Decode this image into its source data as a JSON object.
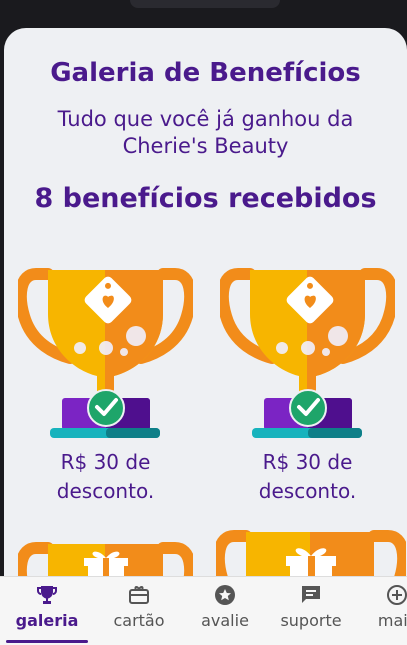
{
  "header": {
    "title": "Galeria de Benefícios",
    "subtitle": "Tudo que você já ganhou da Cherie's Beauty",
    "count_label": "8 benefícios recebidos"
  },
  "benefits": [
    {
      "label": "R$ 30 de desconto.",
      "icon": "trophy-tag-heart-icon"
    },
    {
      "label": "R$ 30 de desconto.",
      "icon": "trophy-tag-heart-icon"
    },
    {
      "label": "",
      "icon": "trophy-gift-icon"
    },
    {
      "label": "",
      "icon": "trophy-gift-icon"
    }
  ],
  "tabs": [
    {
      "label": "galeria",
      "icon": "trophy-icon",
      "active": true
    },
    {
      "label": "cartão",
      "icon": "card-icon",
      "active": false
    },
    {
      "label": "avalie",
      "icon": "star-icon",
      "active": false
    },
    {
      "label": "suporte",
      "icon": "chat-icon",
      "active": false
    },
    {
      "label": "mais",
      "icon": "plus-circle-icon",
      "active": false
    }
  ],
  "colors": {
    "primary": "#4a1a8c",
    "trophy_gold": "#f7b500",
    "trophy_orange": "#f28c1a",
    "base_purple": "#6a1ab0",
    "check_green": "#1ea56a",
    "base_teal": "#17b3bd"
  }
}
